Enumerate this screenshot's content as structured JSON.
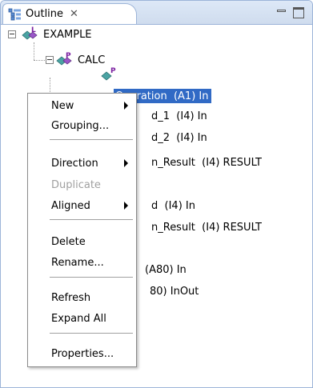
{
  "view": {
    "tab_title": "Outline",
    "close_glyph": "✕",
    "icons": [
      "outline-view-icon",
      "close-icon",
      "minimize-icon",
      "maximize-icon"
    ]
  },
  "tree": {
    "root": {
      "label": "EXAMPLE",
      "badge": "L"
    },
    "child": {
      "label": "CALC",
      "badge": "P"
    },
    "rows": [
      "Operation  (A1) In",
      "d_1  (I4) In",
      "d_2  (I4) In",
      "n_Result  (I4) RESULT",
      "d  (I4) In",
      "n_Result  (I4) RESULT",
      "(A80) In",
      "80) InOut"
    ]
  },
  "context_menu": {
    "items": {
      "new": "New",
      "grouping": "Grouping...",
      "direction": "Direction",
      "duplicate": "Duplicate",
      "aligned": "Aligned",
      "delete": "Delete",
      "rename": "Rename...",
      "refresh": "Refresh",
      "expand_all": "Expand All",
      "properties": "Properties..."
    }
  },
  "colors": {
    "selection": "#316ac5",
    "disabled_text": "#a0a0a0",
    "tab_border": "#9cb4d8"
  }
}
